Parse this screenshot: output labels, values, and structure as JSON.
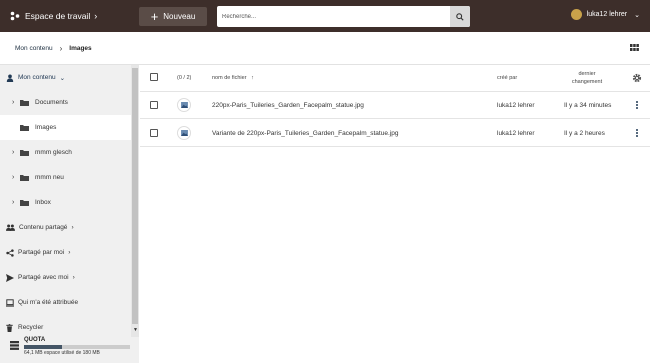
{
  "topbar": {
    "workspace": "Espace de travail",
    "new_button": "Nouveau",
    "search_placeholder": "Recherche...",
    "user_name": "luka12 lehrer"
  },
  "breadcrumb": {
    "root": "Mon contenu",
    "current": "Images"
  },
  "sidebar": {
    "my_content": "Mon contenu",
    "folders": [
      "Documents",
      "Images",
      "mmm glesch",
      "mmm neu",
      "Inbox"
    ],
    "shared_content": "Contenu partagé",
    "shared_by_me": "Partagé par moi",
    "shared_with_me": "Partagé avec moi",
    "assigned_to_me": "Qui m'a été attribuée",
    "recycle": "Recycler",
    "quota_title": "QUOTA",
    "quota_used": "64,1 MB",
    "quota_text": "64,1 MB espace utilisé de 180 MB",
    "quota_fraction": 0.36
  },
  "table": {
    "selection_count": "(0 / 2)",
    "col_name": "nom de fichier",
    "col_created_by": "créé par",
    "col_changed_1": "dernier",
    "col_changed_2": "changement",
    "rows": [
      {
        "name": "220px-Paris_Tuileries_Garden_Facepalm_statue.jpg",
        "created_by": "luka12 lehrer",
        "changed": "Il y a 34 minutes"
      },
      {
        "name": "Variante de 220px-Paris_Tuileries_Garden_Facepalm_statue.jpg",
        "created_by": "luka12 lehrer",
        "changed": "Il y a 2 heures"
      }
    ]
  },
  "colors": {
    "topbar": "#3d2e2a",
    "accent": "#223a55"
  }
}
